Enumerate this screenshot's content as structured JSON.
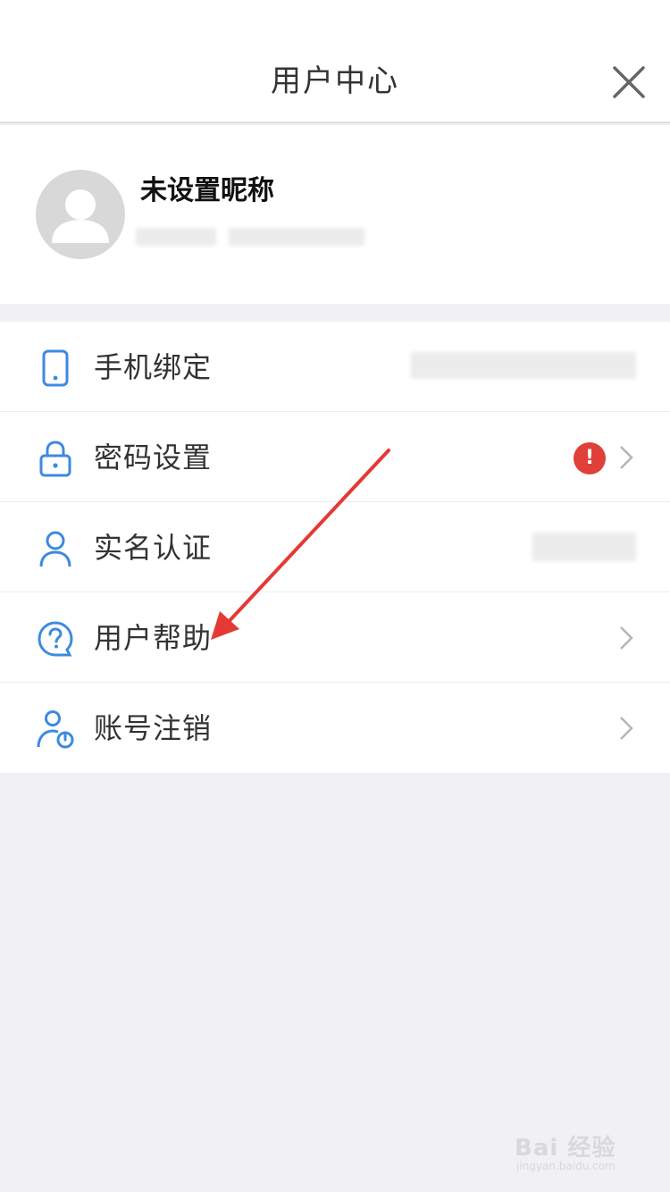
{
  "header": {
    "title": "用户中心",
    "close_icon": "close-icon"
  },
  "profile": {
    "nickname": "未设置昵称",
    "avatar_icon": "default-avatar-icon"
  },
  "menu": {
    "items": [
      {
        "label": "手机绑定",
        "icon": "phone-icon"
      },
      {
        "label": "密码设置",
        "icon": "lock-icon",
        "badge": "!"
      },
      {
        "label": "实名认证",
        "icon": "person-icon"
      },
      {
        "label": "用户帮助",
        "icon": "help-icon"
      },
      {
        "label": "账号注销",
        "icon": "user-power-icon"
      }
    ]
  },
  "watermark": {
    "main": "Bai  经验",
    "sub": "jingyan.baidu.com"
  },
  "colors": {
    "accent": "#3d8ae0",
    "alert": "#e0403a",
    "annotation_arrow": "#e53935"
  }
}
